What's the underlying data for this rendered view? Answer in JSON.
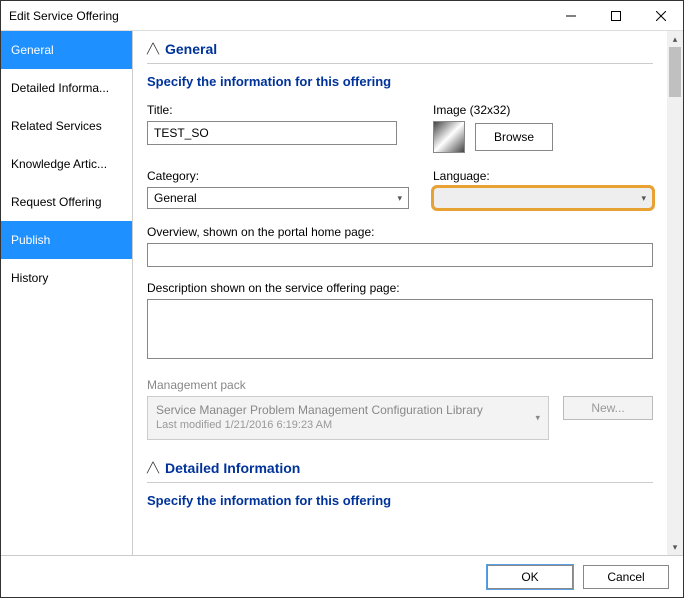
{
  "window": {
    "title": "Edit Service Offering"
  },
  "sidebar": {
    "items": [
      {
        "label": "General"
      },
      {
        "label": "Detailed Informa..."
      },
      {
        "label": "Related Services"
      },
      {
        "label": "Knowledge Artic..."
      },
      {
        "label": "Request Offering"
      },
      {
        "label": "Publish"
      },
      {
        "label": "History"
      }
    ]
  },
  "sections": {
    "general": {
      "title": "General",
      "subtitle": "Specify the information for this offering",
      "title_label": "Title:",
      "title_value": "TEST_SO",
      "image_label": "Image (32x32)",
      "browse_label": "Browse",
      "category_label": "Category:",
      "category_value": "General",
      "language_label": "Language:",
      "language_value": "",
      "overview_label": "Overview, shown on the portal home page:",
      "overview_value": "",
      "description_label": "Description shown on the service offering page:",
      "description_value": "",
      "mp_label": "Management pack",
      "mp_value": "Service Manager Problem Management Configuration Library",
      "mp_modified": "Last modified  1/21/2016 6:19:23 AM",
      "new_label": "New..."
    },
    "detailed": {
      "title": "Detailed Information",
      "subtitle": "Specify the information for this offering"
    }
  },
  "footer": {
    "ok": "OK",
    "cancel": "Cancel"
  }
}
